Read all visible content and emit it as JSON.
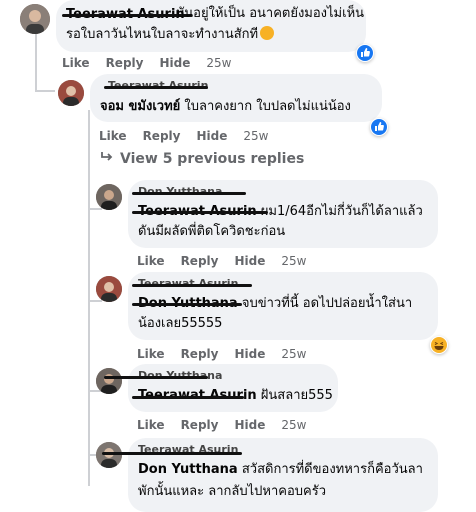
{
  "comments": [
    {
      "author": "Teerawat Asurin",
      "text_line1": "บันอยู่ให้เป็น อนาคตยังมองไม่เห็น",
      "text_line2": "รอใบลาวันไหนใบลาจะทำงานสักที",
      "reaction_icon": "like-icon",
      "like_label": "Like",
      "reply_label": "Reply",
      "hide_label": "Hide",
      "time": "25w"
    },
    {
      "author": "Teerawat Asurin",
      "tag": "จอม ขมังเวทย์",
      "text_line1": " ใบลาคงยาก ใบปลดไม่แน่น้อง",
      "reaction_icon": "like-icon",
      "like_label": "Like",
      "reply_label": "Reply",
      "hide_label": "Hide",
      "time": "25w"
    }
  ],
  "view_previous": "View 5 previous replies",
  "replies": [
    {
      "author": "Don Yutthana",
      "tag": "Teerawat Asurin",
      "text_line1": " ผม1/64อีกไม่กี่วันก็ได้ลาแล้ว",
      "text_line2": "ดันมีผลัดพี่ติดโควิดชะก่อน",
      "like_label": "Like",
      "reply_label": "Reply",
      "hide_label": "Hide",
      "time": "25w"
    },
    {
      "author": "Teerawat Asurin",
      "tag": "Don Yutthana",
      "text_line1": " จบข่าวที่นี้ อดไปปล่อยน้ำใส่นา",
      "text_line2": "น้องเลย55555",
      "reaction_icon": "haha-icon",
      "like_label": "Like",
      "reply_label": "Reply",
      "hide_label": "Hide",
      "time": "25w"
    },
    {
      "author": "Don Yutthana",
      "tag": "Teerawat Asurin",
      "text_line1": " ฝันสลาย555",
      "like_label": "Like",
      "reply_label": "Reply",
      "hide_label": "Hide",
      "time": "25w"
    },
    {
      "author": "Teerawat Asurin",
      "tag": "Don Yutthana",
      "text_line1": " สวัสดิการที่ดีของทหารก็คือวันลา",
      "text_line2": "พักนั้นแหละ ลากลับไปหาคอบครัว"
    }
  ],
  "colors": {
    "bubble": "#f0f2f5",
    "meta_text": "#65676b",
    "like_blue": "#1877f2",
    "haha_yellow": "#f7b125"
  }
}
